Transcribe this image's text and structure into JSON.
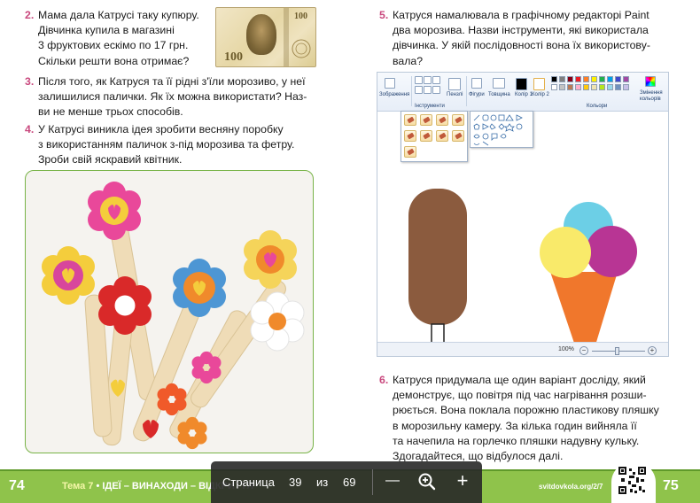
{
  "tasks": {
    "t2": {
      "num": "2.",
      "lines": [
        "Мама дала Катрусі таку купюру.",
        "Дівчинка купила в магазині",
        "3 фруктових ескімо по 17 грн.",
        "Скільки решти вона отримає?"
      ]
    },
    "t3": {
      "num": "3.",
      "lines": [
        "Після того, як Катруся та її рідні з'їли морозиво, у неї",
        "залишилися палички. Як їх можна використати? Наз-",
        "ви не менше трьох способів."
      ]
    },
    "t4": {
      "num": "4.",
      "lines": [
        "У Катрусі виникла ідея зробити весняну поробку",
        "з використанням паличок з-під морозива та фетру.",
        "Зроби свій яскравий квітник."
      ]
    },
    "t5": {
      "num": "5.",
      "lines": [
        "Катруся намалювала в графічному редакторі Paint",
        "два морозива. Назви інструменти, які використала",
        "дівчинка. У якій послідовності вона їх використову-",
        "вала?"
      ]
    },
    "t6": {
      "num": "6.",
      "lines": [
        "Катруся придумала ще один варіант досліду, який",
        "демонструє, що повітря під час нагрівання розши-",
        "рюється. Вона поклала порожню пластикову пляшку",
        "в морозильну камеру. За кілька годин вийняла її",
        "та начепила на горлечко пляшки надувну кульку.",
        "Здогадайтеся, що відбулося далі."
      ]
    }
  },
  "banknote": {
    "value": "100"
  },
  "paint": {
    "ribbon": {
      "image_label": "Зображення",
      "tools_label": "Інструменти",
      "brushes_label": "Пензлі",
      "shapes_label": "Фігури",
      "size_label": "Товщина",
      "color1_label": "Колір 1",
      "color2_label": "Колір 2",
      "edit_colors_label": "Змінення кольорів",
      "colors_group_label": "Кольори"
    },
    "palette": [
      "#000000",
      "#7f7f7f",
      "#880015",
      "#ed1c24",
      "#ff7f27",
      "#fff200",
      "#22b14c",
      "#00a2e8",
      "#3f48cc",
      "#a349a4",
      "#ffffff",
      "#c3c3c3",
      "#b97a57",
      "#ffaec9",
      "#ffc90e",
      "#efe4b0",
      "#b5e61d",
      "#99d9ea",
      "#7092be",
      "#c8bfe7"
    ],
    "colors": {
      "popsicle": "#8b5b3e",
      "cone": "#f0772c",
      "scoop_left": "#f9ea6a",
      "scoop_top": "#6ccfe6",
      "scoop_right": "#b83594"
    },
    "status": {
      "zoom": "100%",
      "minus": "−",
      "plus": "+"
    }
  },
  "footer": {
    "left_page": "74",
    "right_page": "75",
    "theme_prefix": "Тема 7",
    "theme_title": "ІДЕЇ – ВИНАХОДИ – ВІДКРИТТЯ",
    "site": "svitdovkola.org/2/7"
  },
  "viewer": {
    "page_label": "Страница",
    "current": "39",
    "of_label": "из",
    "total": "69",
    "zoom_out": "—",
    "zoom_in_icon": "magnifier-plus-icon",
    "zoom_in2": "+"
  },
  "accent": {
    "task_number": "#c9497e",
    "footer_green": "#8fc34b"
  }
}
